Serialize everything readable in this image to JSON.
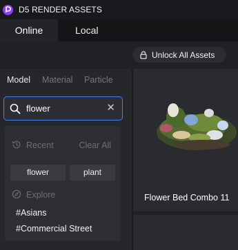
{
  "app": {
    "title": "D5 RENDER ASSETS",
    "logo_icon": "d5-logo-icon",
    "brand_color": "#8a3ff5"
  },
  "tabs": [
    {
      "label": "Online",
      "active": true
    },
    {
      "label": "Local",
      "active": false
    }
  ],
  "unlock": {
    "label": "Unlock All Assets",
    "icon": "lock-icon"
  },
  "categories": [
    {
      "label": "Model",
      "active": true
    },
    {
      "label": "Material",
      "active": false
    },
    {
      "label": "Particle",
      "active": false
    }
  ],
  "search": {
    "value": "flower",
    "icon": "search-icon",
    "clear_icon": "close-icon",
    "focus_color": "#3f83f2"
  },
  "dropdown": {
    "recent_label": "Recent",
    "clear_all_label": "Clear All",
    "recent_items": [
      "flower",
      "plant"
    ],
    "explore_label": "Explore",
    "explore_items": [
      "#Asians",
      "#Commercial Street"
    ]
  },
  "assets": [
    {
      "name": "Flower Bed Combo 11"
    }
  ]
}
